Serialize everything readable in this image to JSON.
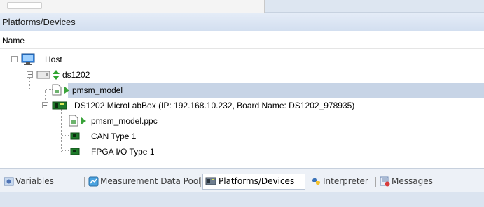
{
  "panel": {
    "title": "Platforms/Devices"
  },
  "columns": {
    "name": "Name"
  },
  "tree": {
    "host": "Host",
    "ds1202": "ds1202",
    "pmsm_model": "pmsm_model",
    "board": "DS1202 MicroLabBox (IP: 192.168.10.232, Board Name: DS1202_978935)",
    "ppc": "pmsm_model.ppc",
    "can": "CAN Type 1",
    "fpga": "FPGA I/O Type 1"
  },
  "tabs": [
    {
      "label": "Variables",
      "icon": "variables-icon"
    },
    {
      "label": "Measurement Data Pool",
      "icon": "measurement-data-pool-icon"
    },
    {
      "label": "Platforms/Devices",
      "icon": "platforms-devices-icon",
      "active": true
    },
    {
      "label": "Interpreter",
      "icon": "interpreter-icon"
    },
    {
      "label": "Messages",
      "icon": "messages-icon"
    }
  ],
  "colors": {
    "selection": "#c7d4e6",
    "run_green": "#3aa33a",
    "header_bg": "#dbe5f3"
  }
}
